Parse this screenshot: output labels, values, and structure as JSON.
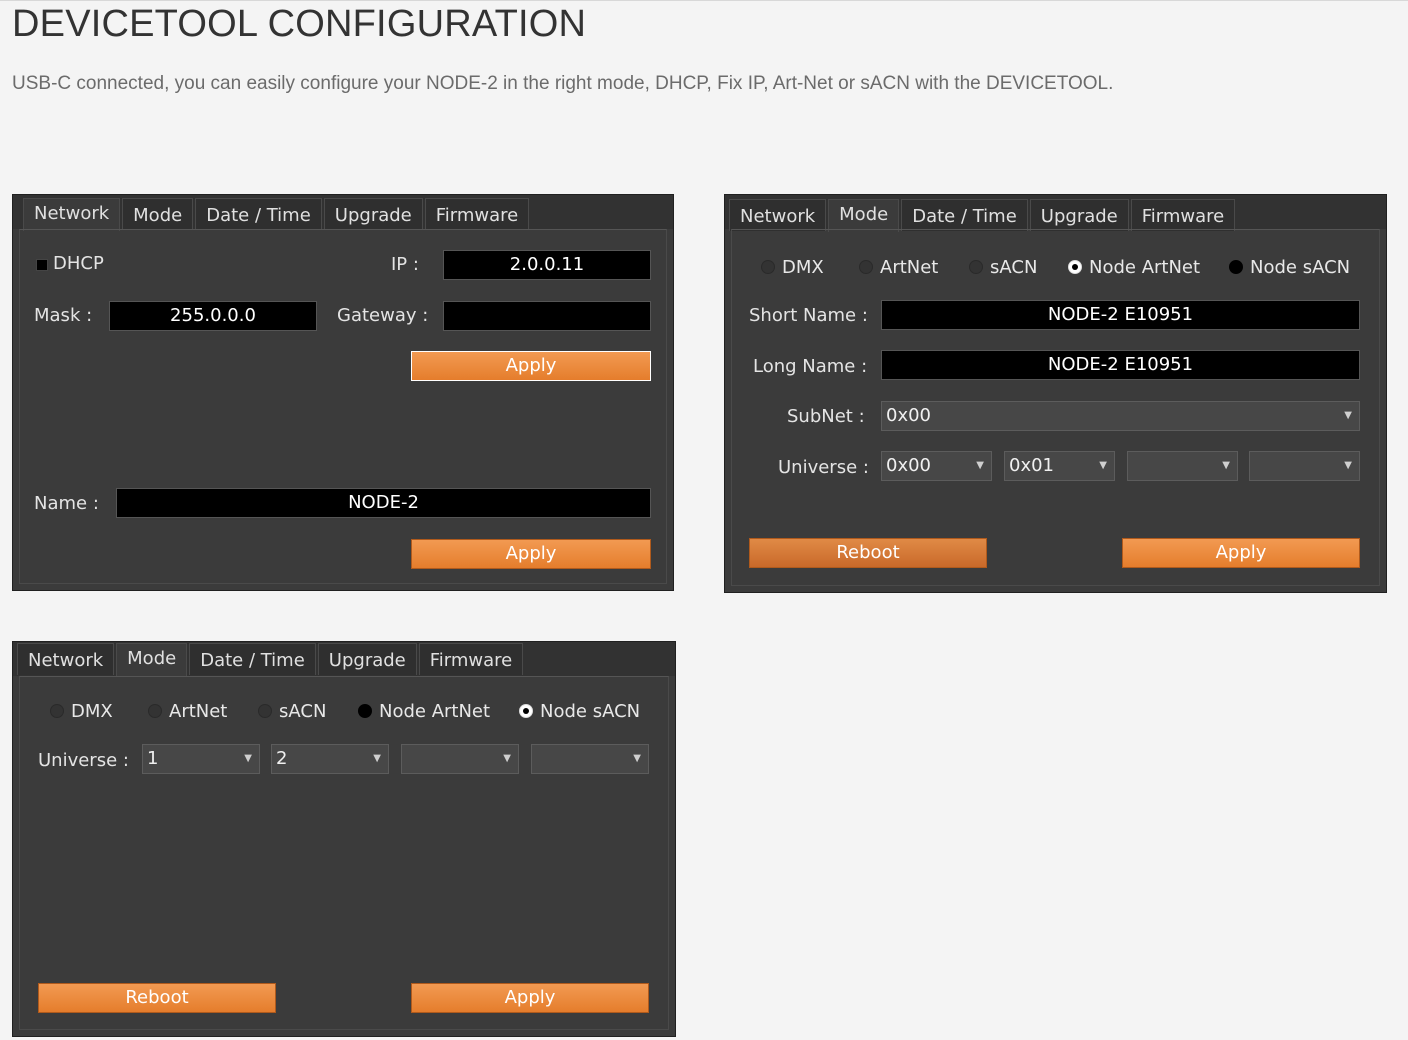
{
  "page": {
    "title": "DEVICETOOL CONFIGURATION",
    "intro": "USB-C connected, you can easily configure your NODE-2 in the right mode, DHCP, Fix IP, Art-Net or sACN with the DEVICETOOL."
  },
  "tabs": [
    "Network",
    "Mode",
    "Date / Time",
    "Upgrade",
    "Firmware"
  ],
  "network_window": {
    "active_tab": "Network",
    "dhcp_label": "DHCP",
    "dhcp_checked": false,
    "ip_label": "IP :",
    "ip_value": "2.0.0.11",
    "mask_label": "Mask :",
    "mask_value": "255.0.0.0",
    "gateway_label": "Gateway :",
    "gateway_value": "",
    "apply_label": "Apply",
    "name_label": "Name :",
    "name_value": "NODE-2",
    "apply2_label": "Apply"
  },
  "mode_window_1": {
    "active_tab": "Mode",
    "radios": [
      {
        "label": "DMX",
        "state": "off"
      },
      {
        "label": "ArtNet",
        "state": "off"
      },
      {
        "label": "sACN",
        "state": "off"
      },
      {
        "label": "Node ArtNet",
        "state": "selected"
      },
      {
        "label": "Node sACN",
        "state": "filled"
      }
    ],
    "short_name_label": "Short Name :",
    "short_name_value": "NODE-2 E10951",
    "long_name_label": "Long Name :",
    "long_name_value": "NODE-2 E10951",
    "subnet_label": "SubNet :",
    "subnet_value": "0x00",
    "universe_label": "Universe :",
    "universe_values": [
      "0x00",
      "0x01",
      "",
      ""
    ],
    "reboot_label": "Reboot",
    "apply_label": "Apply"
  },
  "mode_window_2": {
    "active_tab": "Mode",
    "radios": [
      {
        "label": "DMX",
        "state": "off"
      },
      {
        "label": "ArtNet",
        "state": "off"
      },
      {
        "label": "sACN",
        "state": "off"
      },
      {
        "label": "Node ArtNet",
        "state": "filled"
      },
      {
        "label": "Node sACN",
        "state": "selected"
      }
    ],
    "universe_label": "Universe :",
    "universe_values": [
      "1",
      "2",
      "",
      ""
    ],
    "reboot_label": "Reboot",
    "apply_label": "Apply"
  },
  "colors": {
    "accent_orange": "#e8843a",
    "window_bg": "#3b3b3b",
    "field_bg": "#000000"
  }
}
